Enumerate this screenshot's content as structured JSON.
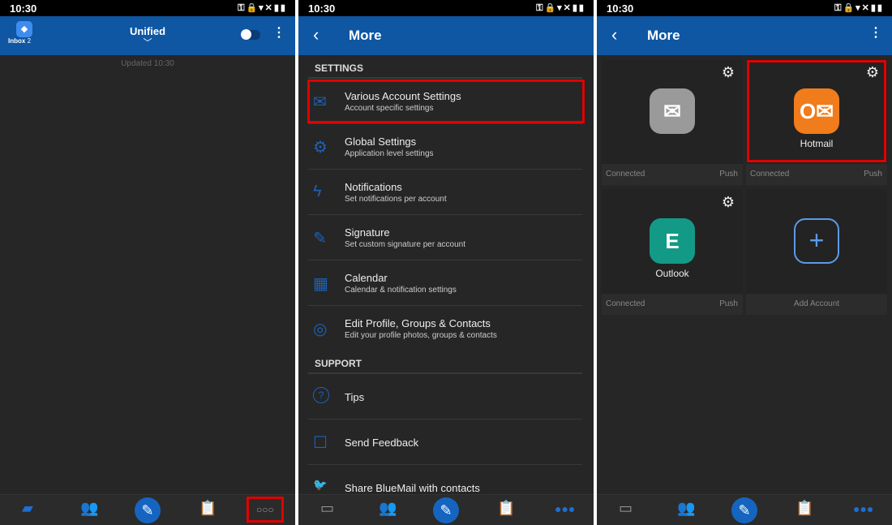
{
  "status": {
    "time": "10:30",
    "icons": "⚿🔒▾✕▮▮"
  },
  "panel1": {
    "title": "Unified",
    "inbox_label": "Inbox",
    "inbox_count": "2",
    "updated": "Updated 10:30"
  },
  "panel2": {
    "title": "More",
    "settings_header": "SETTINGS",
    "support_header": "SUPPORT",
    "items": [
      {
        "title": "Various Account Settings",
        "subtitle": "Account specific settings",
        "icon": "✉"
      },
      {
        "title": "Global Settings",
        "subtitle": "Application level settings",
        "icon": "⚙"
      },
      {
        "title": "Notifications",
        "subtitle": "Set notifications per account",
        "icon": "ϟ"
      },
      {
        "title": "Signature",
        "subtitle": "Set custom signature per account",
        "icon": "✎"
      },
      {
        "title": "Calendar",
        "subtitle": "Calendar & notification settings",
        "icon": "▦"
      },
      {
        "title": "Edit Profile, Groups & Contacts",
        "subtitle": "Edit your profile photos, groups & contacts",
        "icon": "◎"
      }
    ],
    "support": [
      {
        "title": "Tips",
        "icon": "?"
      },
      {
        "title": "Send Feedback",
        "icon": "☐"
      },
      {
        "title": "Share BlueMail with contacts",
        "icon": "🐦"
      }
    ]
  },
  "panel3": {
    "title": "More",
    "accounts": [
      {
        "name": "",
        "status": "Connected",
        "mode": "Push",
        "color": "#9a9a9a"
      },
      {
        "name": "Hotmail",
        "status": "Connected",
        "mode": "Push",
        "color": "#f07c1b"
      },
      {
        "name": "Outlook",
        "status": "Connected",
        "mode": "Push",
        "color": "#139a86"
      }
    ],
    "add_label": "Add Account"
  },
  "colors": {
    "header": "#0f56a3",
    "highlight": "#e00000"
  }
}
